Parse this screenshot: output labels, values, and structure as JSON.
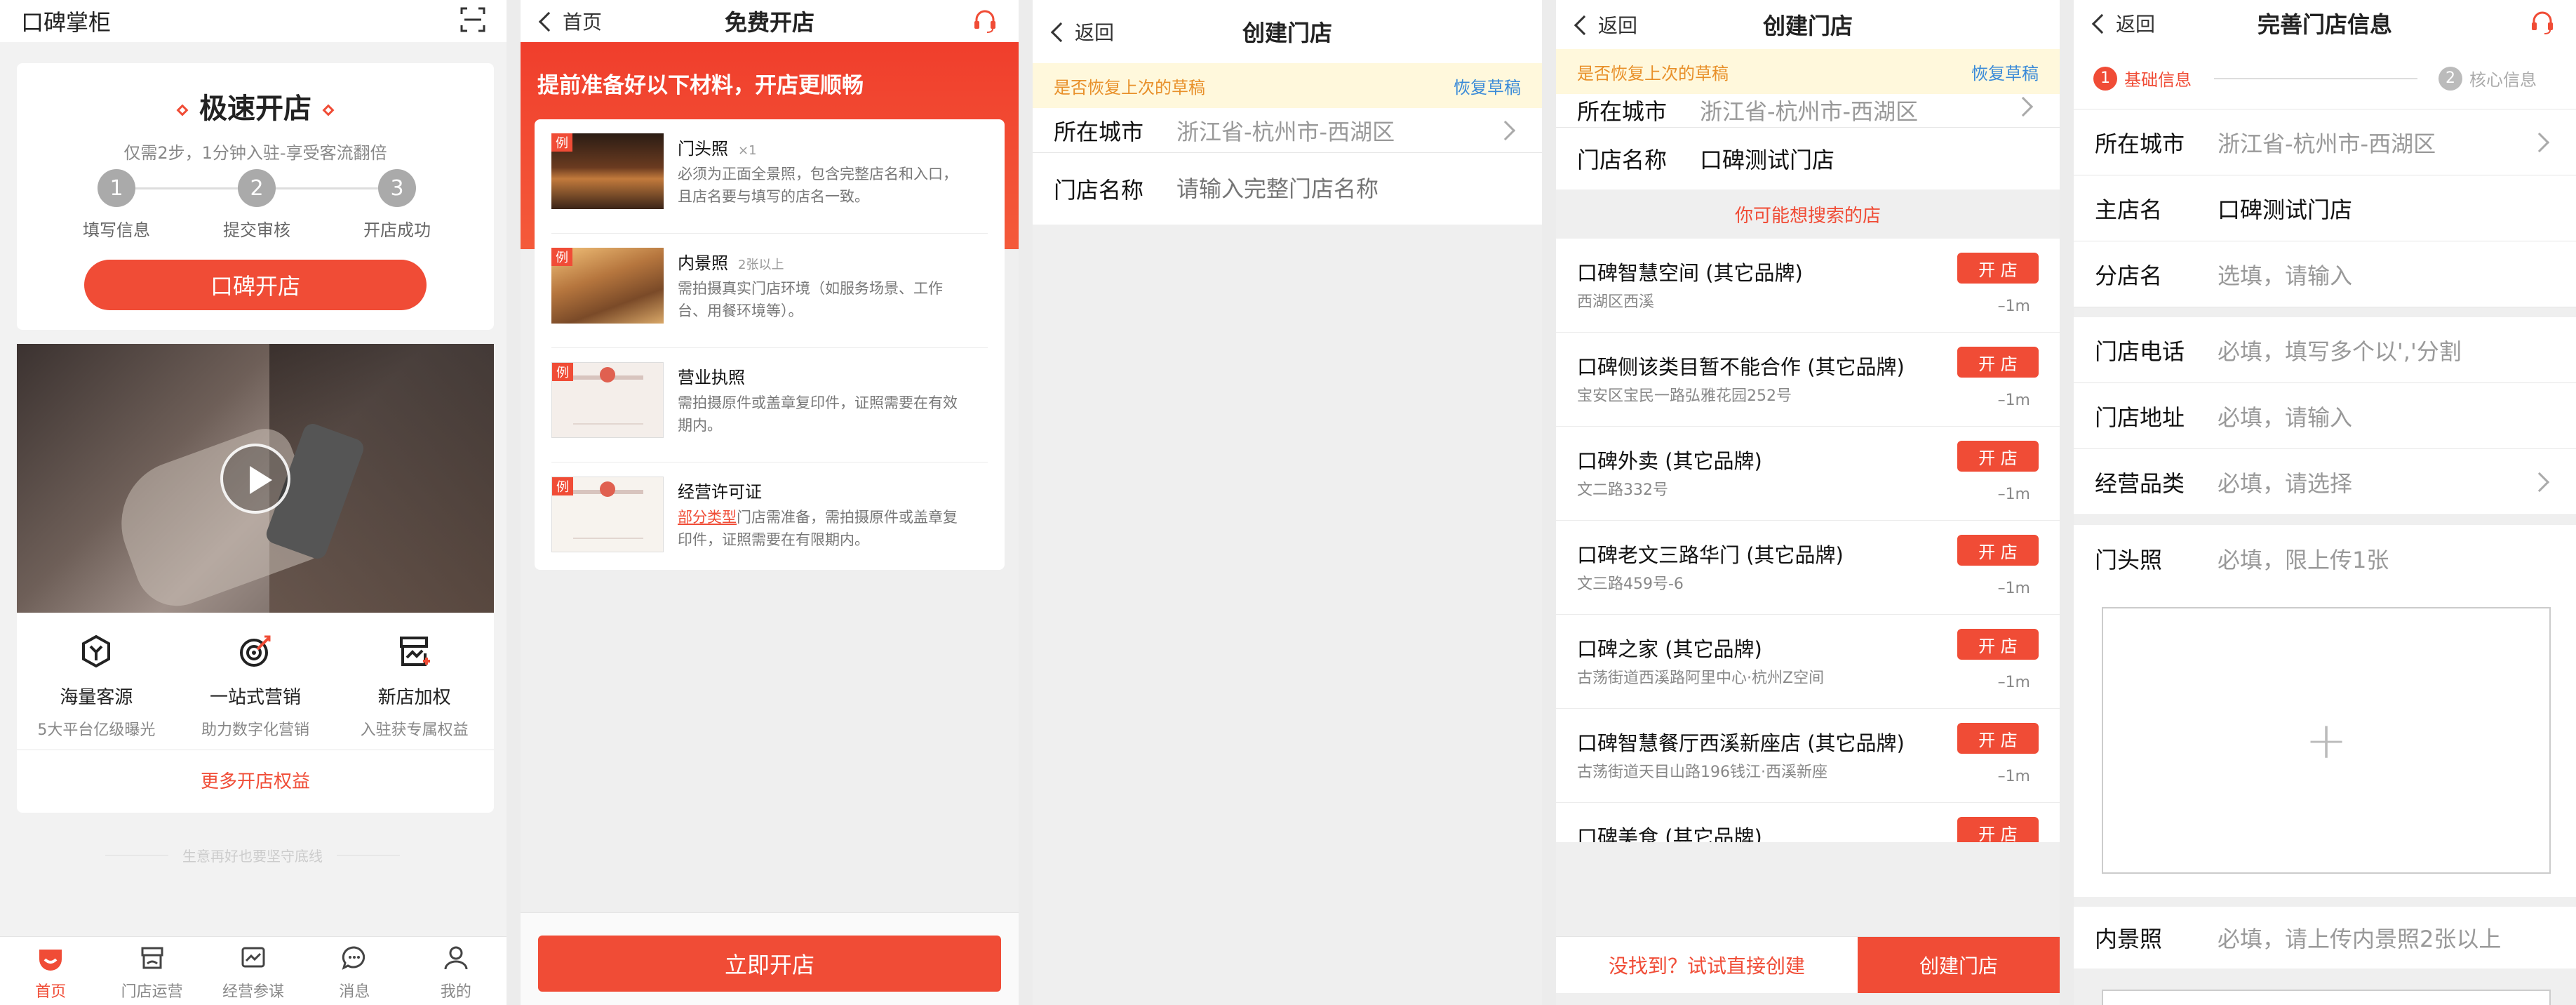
{
  "colors": {
    "accent": "#f04c36",
    "draft_bg": "#fff8dc",
    "draft_text": "#e8902a",
    "link_blue": "#3a8ad8"
  },
  "s1": {
    "title": "口碑掌柜",
    "hero_title": "极速开店",
    "hero_sub": "仅需2步，1分钟入驻-享受客流翻倍",
    "steps": [
      {
        "num": "1",
        "label": "填写信息"
      },
      {
        "num": "2",
        "label": "提交审核"
      },
      {
        "num": "3",
        "label": "开店成功"
      }
    ],
    "cta": "口碑开店",
    "features": [
      {
        "icon": "hexagon-y-icon",
        "title": "海量客源",
        "desc": "5大平台亿级曝光"
      },
      {
        "icon": "target-icon",
        "title": "一站式营销",
        "desc": "助力数字化营销"
      },
      {
        "icon": "store-plus-icon",
        "title": "新店加权",
        "desc": "入驻获专属权益"
      }
    ],
    "more": "更多开店权益",
    "footer_slogan": "生意再好也要坚守底线",
    "tabs": [
      {
        "icon": "home-icon",
        "label": "首页",
        "active": true
      },
      {
        "icon": "store-icon",
        "label": "门店运营",
        "active": false
      },
      {
        "icon": "chart-icon",
        "label": "经营参谋",
        "active": false
      },
      {
        "icon": "message-icon",
        "label": "消息",
        "active": false
      },
      {
        "icon": "user-icon",
        "label": "我的",
        "active": false
      }
    ]
  },
  "s2": {
    "back": "首页",
    "title": "免费开店",
    "banner": "提前准备好以下材料，开店更顺畅",
    "example_badge": "例",
    "items": [
      {
        "title": "门头照",
        "tag": "×1",
        "desc_lines": [
          "必须为正面全景照，包含完整店名和入口，",
          "且店名要与填写的店名一致。"
        ]
      },
      {
        "title": "内景照",
        "tag": "2张以上",
        "desc_lines": [
          "需拍摄真实门店环境（如服务场景、工作",
          "台、用餐环境等）。"
        ]
      },
      {
        "title": "营业执照",
        "tag": "",
        "desc_lines": [
          "需拍摄原件或盖章复印件，证照需要在有效",
          "期内。"
        ]
      },
      {
        "title": "经营许可证",
        "tag": "",
        "link": "部分类型",
        "desc_lines": [
          "门店需准备，需拍摄原件或盖章复",
          "印件，证照需要在有限期内。"
        ]
      }
    ],
    "cta": "立即开店"
  },
  "s3": {
    "back": "返回",
    "title": "创建门店",
    "draft_text": "是否恢复上次的草稿",
    "draft_action": "恢复草稿",
    "city_label": "所在城市",
    "city_value": "浙江省-杭州市-西湖区",
    "name_label": "门店名称",
    "name_placeholder": "请输入完整门店名称"
  },
  "s4": {
    "back": "返回",
    "title": "创建门店",
    "draft_text": "是否恢复上次的草稿",
    "draft_action": "恢复草稿",
    "city_label": "所在城市",
    "city_value": "浙江省-杭州市-西湖区",
    "name_label": "门店名称",
    "name_value": "口碑测试门店",
    "suggest_header": "你可能想搜索的店",
    "open_btn": "开 店",
    "results": [
      {
        "name": "口碑智慧空间 (其它品牌)",
        "addr": "西湖区西溪",
        "dist": "–1m"
      },
      {
        "name": "口碑侧该类目暂不能合作 (其它品牌)",
        "addr": "宝安区宝民一路弘雅花园252号",
        "dist": "–1m"
      },
      {
        "name": "口碑外卖 (其它品牌)",
        "addr": "文二路332号",
        "dist": "–1m"
      },
      {
        "name": "口碑老文三路华门 (其它品牌)",
        "addr": "文三路459号-6",
        "dist": "–1m"
      },
      {
        "name": "口碑之家 (其它品牌)",
        "addr": "古荡街道西溪路阿里中心·杭州Z空间",
        "dist": "–1m"
      },
      {
        "name": "口碑智慧餐厅西溪新座店 (其它品牌)",
        "addr": "古荡街道天目山路196钱江·西溪新座",
        "dist": "–1m"
      },
      {
        "name": "口碑美食 (其它品牌)",
        "addr": "",
        "dist": ""
      }
    ],
    "bottom_left": "没找到？试试直接创建",
    "bottom_right": "创建门店"
  },
  "s5": {
    "back": "返回",
    "title": "完善门店信息",
    "steps": [
      {
        "num": "1",
        "label": "基础信息",
        "active": true
      },
      {
        "num": "2",
        "label": "核心信息",
        "active": false
      }
    ],
    "rows_a": [
      {
        "k": "所在城市",
        "v": "浙江省-杭州市-西湖区",
        "dark": false,
        "arrow": true
      },
      {
        "k": "主店名",
        "v": "口碑测试门店",
        "dark": true,
        "arrow": false
      },
      {
        "k": "分店名",
        "v": "选填，请输入",
        "dark": false,
        "arrow": false
      }
    ],
    "rows_b": [
      {
        "k": "门店电话",
        "v": "必填，填写多个以','分割",
        "dark": false,
        "arrow": false
      },
      {
        "k": "门店地址",
        "v": "必填，请输入",
        "dark": false,
        "arrow": false
      },
      {
        "k": "经营品类",
        "v": "必填，请选择",
        "dark": false,
        "arrow": true
      }
    ],
    "door_label": "门头照",
    "door_hint": "必填，限上传1张",
    "upload_plus": "+",
    "interior_label": "内景照",
    "interior_hint": "必填，请上传内景照2张以上"
  }
}
